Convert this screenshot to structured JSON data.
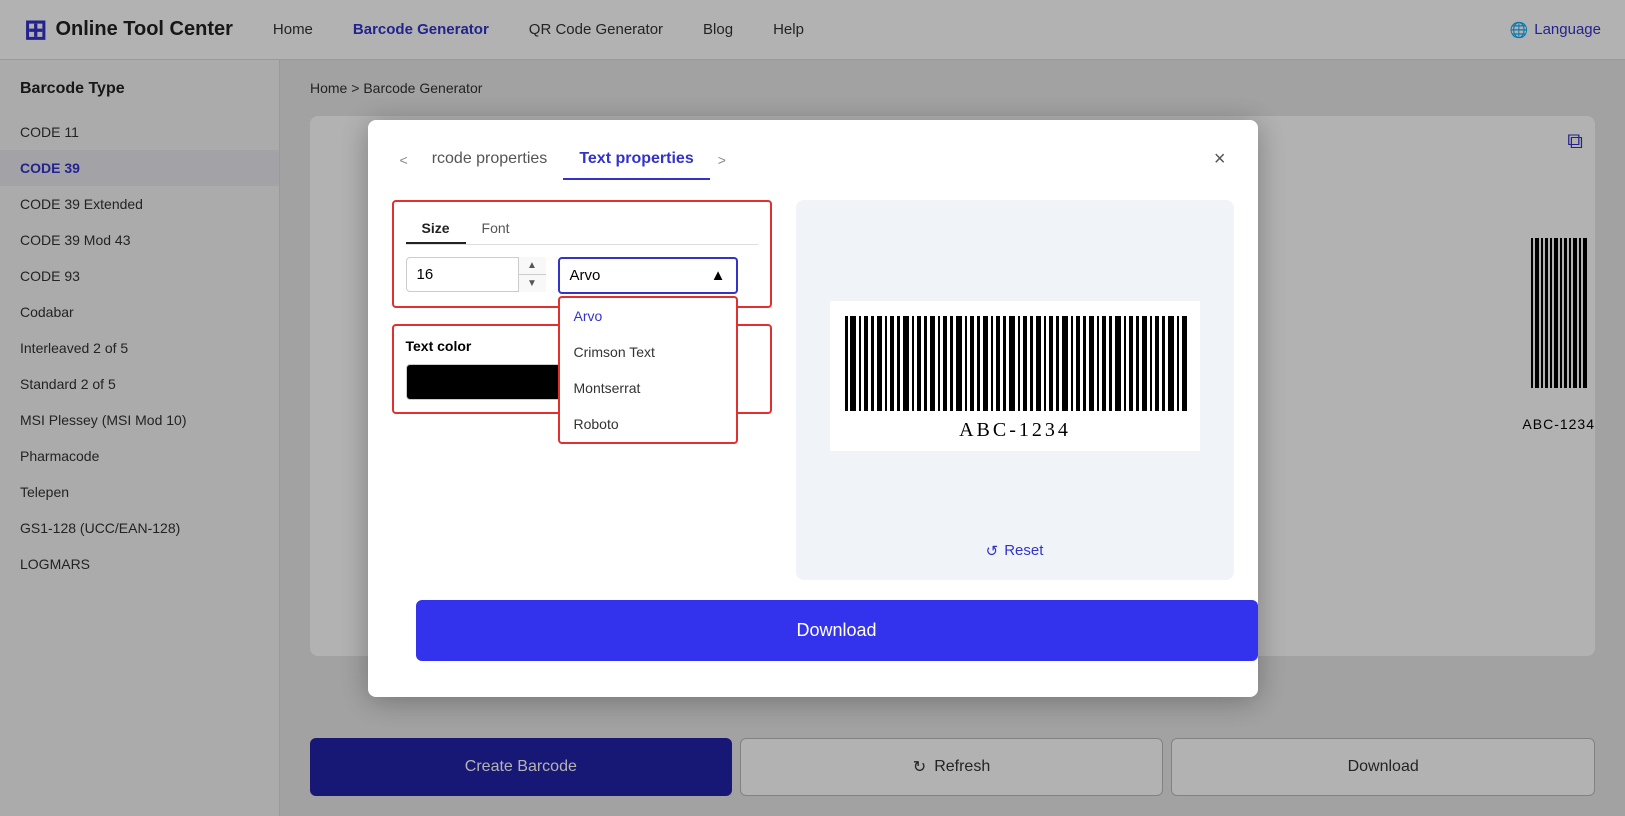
{
  "nav": {
    "logo_text": "Online Tool Center",
    "links": [
      {
        "label": "Home",
        "active": false
      },
      {
        "label": "Barcode Generator",
        "active": true
      },
      {
        "label": "QR Code Generator",
        "active": false
      },
      {
        "label": "Blog",
        "active": false
      },
      {
        "label": "Help",
        "active": false
      }
    ],
    "language_label": "Language"
  },
  "sidebar": {
    "title": "Barcode Type",
    "items": [
      {
        "label": "CODE 11",
        "active": false
      },
      {
        "label": "CODE 39",
        "active": true
      },
      {
        "label": "CODE 39 Extended",
        "active": false
      },
      {
        "label": "CODE 39 Mod 43",
        "active": false
      },
      {
        "label": "CODE 93",
        "active": false
      },
      {
        "label": "Codabar",
        "active": false
      },
      {
        "label": "Interleaved 2 of 5",
        "active": false
      },
      {
        "label": "Standard 2 of 5",
        "active": false
      },
      {
        "label": "MSI Plessey (MSI Mod 10)",
        "active": false
      },
      {
        "label": "Pharmacode",
        "active": false
      },
      {
        "label": "Telepen",
        "active": false
      },
      {
        "label": "GS1-128 (UCC/EAN-128)",
        "active": false
      },
      {
        "label": "LOGMARS",
        "active": false
      }
    ]
  },
  "breadcrumb": {
    "home": "Home",
    "separator": ">",
    "current": "Barcode Generator"
  },
  "bottom_buttons": {
    "create": "Create Barcode",
    "refresh": "Refresh",
    "download": "Download"
  },
  "modal": {
    "tab_prev_arrow": "<",
    "tab_barcode": "rcode properties",
    "tab_text": "Text properties",
    "tab_next_arrow": ">",
    "close": "×",
    "inner_tabs": {
      "size_label": "Size",
      "font_label": "Font"
    },
    "size_value": "16",
    "font_selected": "Arvo",
    "font_options": [
      {
        "label": "Arvo",
        "selected": true
      },
      {
        "label": "Crimson Text",
        "selected": false
      },
      {
        "label": "Montserrat",
        "selected": false
      },
      {
        "label": "Roboto",
        "selected": false
      }
    ],
    "text_color_label": "Text color",
    "color_value": "#000000",
    "reset_label": "Reset",
    "download_label": "Download",
    "barcode_text": "ABC-1234"
  }
}
